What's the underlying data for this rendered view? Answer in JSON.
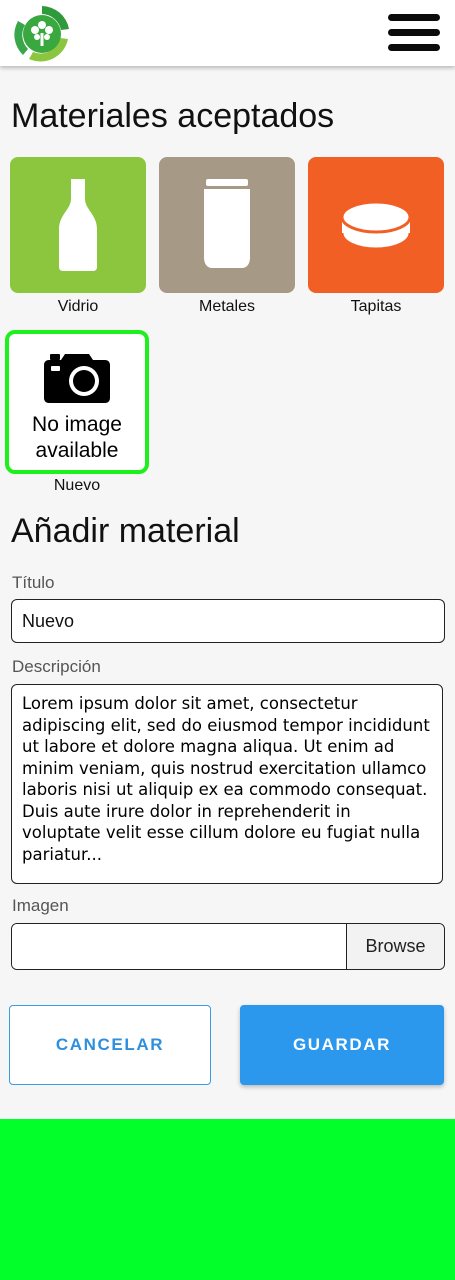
{
  "header": {
    "logo_icon": "recycling-tree-logo",
    "menu_icon": "hamburger-menu-icon"
  },
  "accepted": {
    "title": "Materiales aceptados",
    "tiles": [
      {
        "label": "Vidrio",
        "color": "#8cc63f",
        "icon": "bottle-icon"
      },
      {
        "label": "Metales",
        "color": "#a69986",
        "icon": "can-icon"
      },
      {
        "label": "Tapitas",
        "color": "#f15f25",
        "icon": "bottle-cap-icon"
      }
    ],
    "new_tile": {
      "label": "Nuevo",
      "placeholder_lines": [
        "No image",
        "available"
      ],
      "border_color": "#1ef01e"
    }
  },
  "form": {
    "title": "Añadir material",
    "titulo_label": "Título",
    "titulo_value": "Nuevo",
    "descripcion_label": "Descripción",
    "descripcion_value": "Lorem ipsum dolor sit amet, consectetur adipiscing elit, sed do eiusmod tempor incididunt ut labore et dolore magna aliqua. Ut enim ad minim veniam, quis nostrud exercitation ullamco laboris nisi ut aliquip ex ea commodo consequat. Duis aute irure dolor in reprehenderit in voluptate velit esse cillum dolore eu fugiat nulla pariatur...",
    "imagen_label": "Imagen",
    "browse_label": "Browse",
    "cancel_label": "CANCELAR",
    "save_label": "GUARDAR"
  },
  "colors": {
    "accent": "#2b98ee",
    "footer": "#02ff2a"
  }
}
